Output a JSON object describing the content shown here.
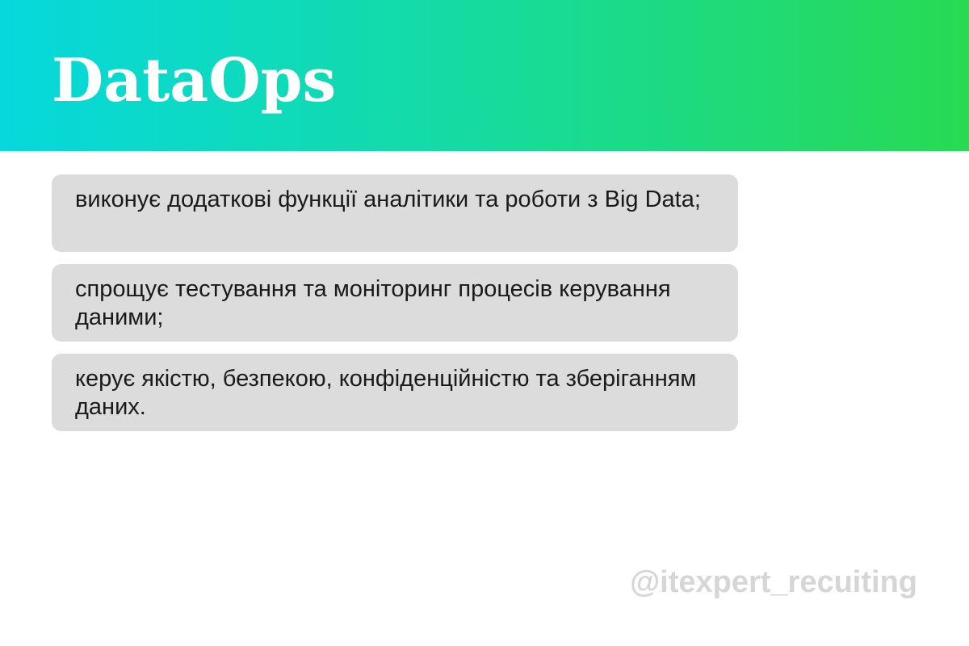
{
  "colors": {
    "header_gradient_start": "#06d8dc",
    "header_gradient_end": "#28da52",
    "card_background": "#dcdcdc",
    "watermark": "#d6d6d6"
  },
  "header": {
    "title": "DataOps"
  },
  "cards": [
    {
      "text": "виконує додаткові функції аналітики та роботи з Big Data;"
    },
    {
      "text": "спрощує тестування та моніторинг процесів керування даними;"
    },
    {
      "text": "керує якістю, безпекою, конфіденційністю та зберіганням даних."
    }
  ],
  "watermark": {
    "text": "@itexpert_recuiting"
  }
}
